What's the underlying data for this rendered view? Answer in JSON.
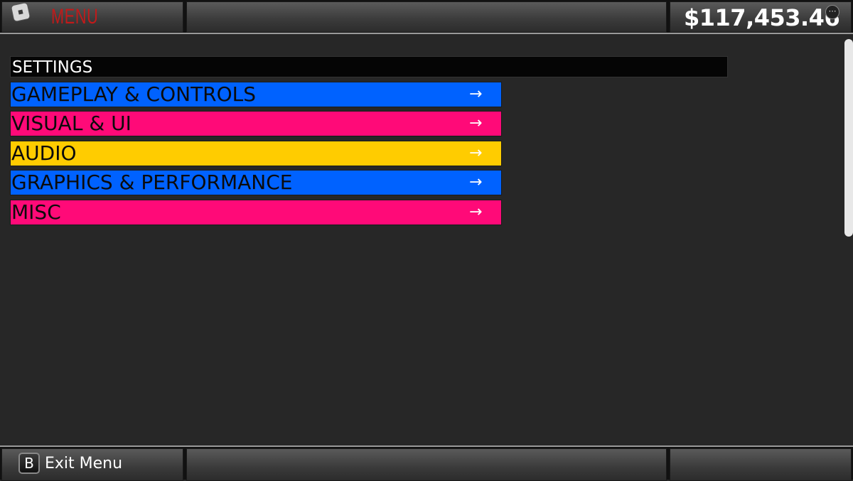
{
  "header": {
    "title": "MENU",
    "money": "$117,453.46",
    "more_symbol": "⋯"
  },
  "settings": {
    "title": "SETTINGS",
    "categories": [
      {
        "label": "GAMEPLAY & CONTROLS",
        "color": "#0062ff"
      },
      {
        "label": "VISUAL & UI",
        "color": "#ff0a78"
      },
      {
        "label": "AUDIO",
        "color": "#ffcc00"
      },
      {
        "label": "GRAPHICS & PERFORMANCE",
        "color": "#0062ff"
      },
      {
        "label": "MISC",
        "color": "#ff0a78"
      }
    ],
    "arrow": "→"
  },
  "footer": {
    "button_key": "B",
    "exit_label": "Exit Menu"
  },
  "icons": {
    "logo": "roblox-logo-icon",
    "more": "more-options-icon",
    "arrow": "arrow-right-icon"
  }
}
